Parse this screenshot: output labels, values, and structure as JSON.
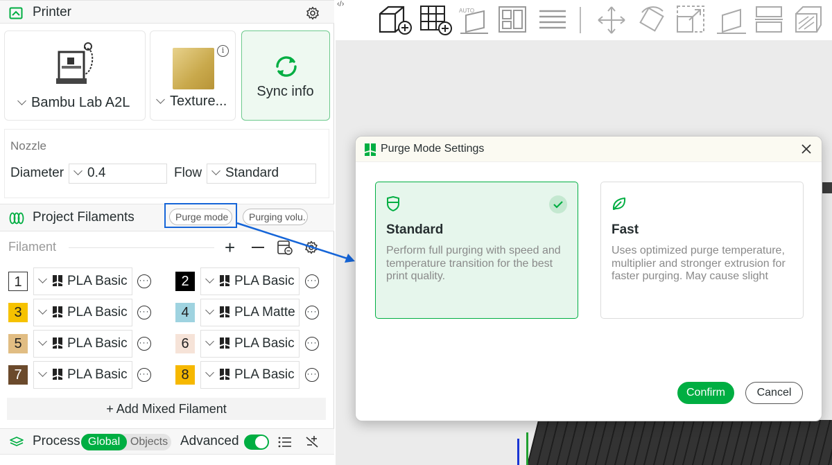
{
  "printer": {
    "title": "Printer",
    "printer_name": "Bambu Lab A2L",
    "plate_name": "Texture...",
    "sync_label": "Sync info"
  },
  "nozzle": {
    "section_label": "Nozzle",
    "diameter_label": "Diameter",
    "diameter_value": "0.4",
    "flow_label": "Flow",
    "flow_value": "Standard"
  },
  "filaments": {
    "title": "Project Filaments",
    "purge_mode_label": "Purge mode",
    "purging_volume_label": "Purging volu...",
    "list_label": "Filament",
    "add_mixed_label": "+ Add Mixed Filament",
    "items": [
      {
        "num": "1",
        "name": "PLA Basic",
        "color": "#ffffff",
        "text_color": "#222222"
      },
      {
        "num": "2",
        "name": "PLA Basic",
        "color": "#000000",
        "text_color": "#ffffff"
      },
      {
        "num": "3",
        "name": "PLA Basic",
        "color": "#f6c200",
        "text_color": "#222222"
      },
      {
        "num": "4",
        "name": "PLA Matte",
        "color": "#9fd3e0",
        "text_color": "#222222"
      },
      {
        "num": "5",
        "name": "PLA Basic",
        "color": "#e1bd83",
        "text_color": "#222222"
      },
      {
        "num": "6",
        "name": "PLA Basic",
        "color": "#f6e3d8",
        "text_color": "#222222"
      },
      {
        "num": "7",
        "name": "PLA Basic",
        "color": "#6b4a2c",
        "text_color": "#ffffff"
      },
      {
        "num": "8",
        "name": "PLA Basic",
        "color": "#f6b800",
        "text_color": "#222222"
      }
    ]
  },
  "process": {
    "title": "Process",
    "global_label": "Global",
    "objects_label": "Objects",
    "advanced_label": "Advanced"
  },
  "dialog": {
    "title": "Purge Mode Settings",
    "options": [
      {
        "title": "Standard",
        "description": "Perform full purging with speed and temperature transition for the best print quality.",
        "selected": true
      },
      {
        "title": "Fast",
        "description": "Uses optimized purge temperature, multiplier and stronger extrusion for\nfaster purging. May cause slight",
        "selected": false
      }
    ],
    "confirm_label": "Confirm",
    "cancel_label": "Cancel"
  },
  "colors": {
    "brand_green": "#00ae42",
    "highlight_blue": "#1565d8",
    "selected_bg": "#e6f6ec"
  }
}
